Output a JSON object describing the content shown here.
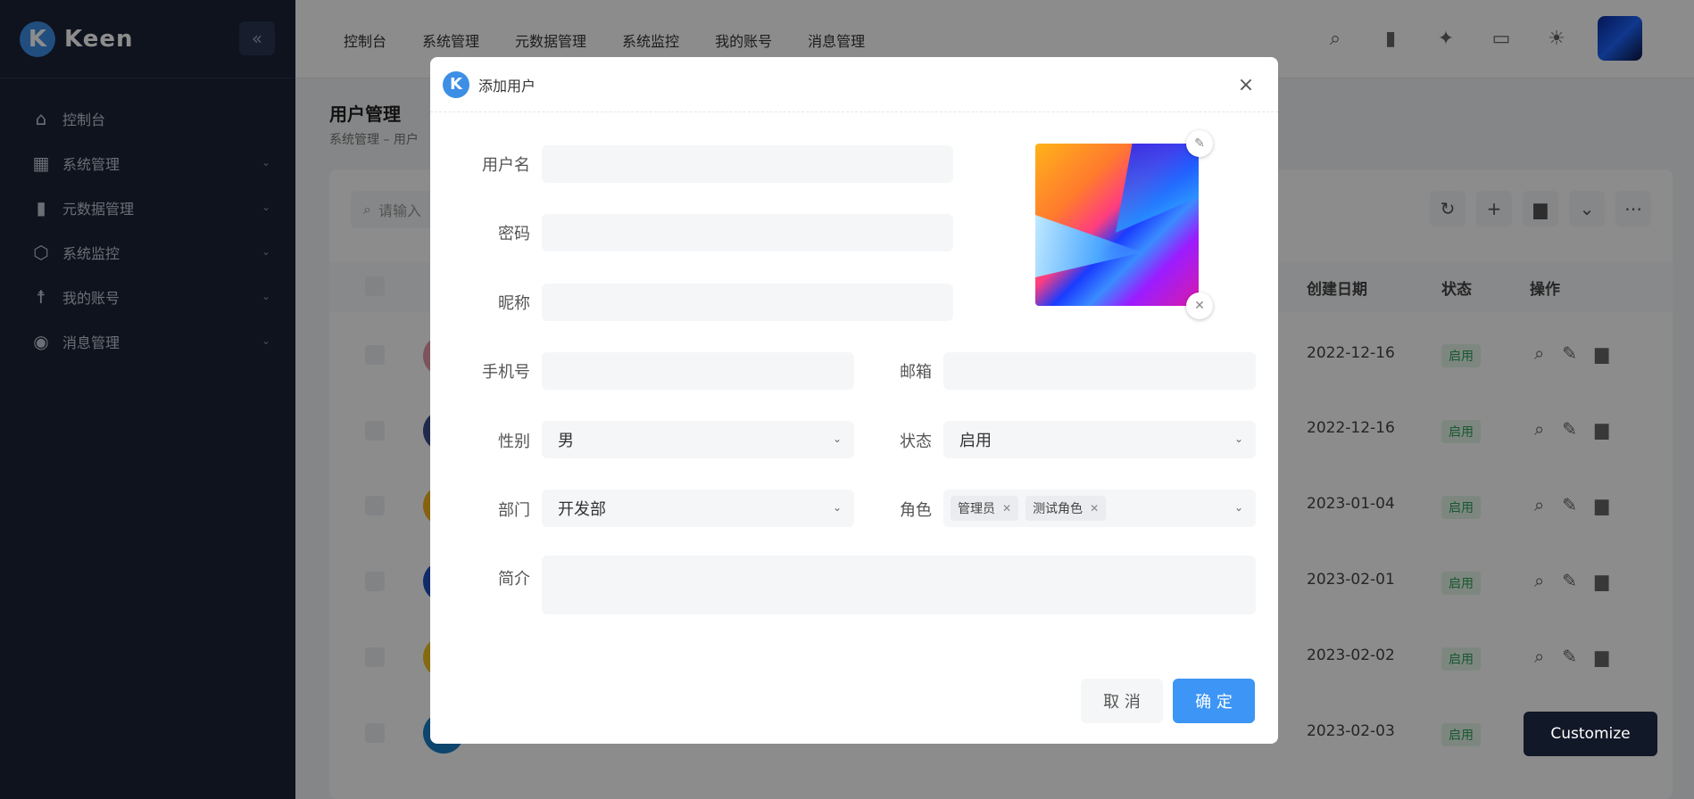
{
  "app": {
    "name": "Keen",
    "logo_letter": "K"
  },
  "sidebar": {
    "collapse_icon": "double-chevron-left-icon",
    "items": [
      {
        "label": "控制台",
        "icon": "home-icon",
        "glyph": "⌂"
      },
      {
        "label": "系统管理",
        "icon": "grid-icon",
        "glyph": "▦"
      },
      {
        "label": "元数据管理",
        "icon": "bar-chart-icon",
        "glyph": "▮"
      },
      {
        "label": "系统监控",
        "icon": "cube-icon",
        "glyph": "⬡"
      },
      {
        "label": "我的账号",
        "icon": "person-icon",
        "glyph": "☨"
      },
      {
        "label": "消息管理",
        "icon": "messenger-icon",
        "glyph": "◉"
      }
    ]
  },
  "topnav": [
    "控制台",
    "系统管理",
    "元数据管理",
    "系统监控",
    "我的账号",
    "消息管理"
  ],
  "page": {
    "title": "用户管理",
    "breadcrumb": "系统管理 – 用户",
    "search_placeholder": "请输入",
    "table_headers": {
      "created": "创建日期",
      "status": "状态",
      "ops": "操作"
    },
    "rows": [
      {
        "date": "2022-12-16",
        "status": "启用"
      },
      {
        "date": "2022-12-16",
        "status": "启用"
      },
      {
        "date": "2023-01-04",
        "status": "启用"
      },
      {
        "date": "2023-02-01",
        "status": "启用"
      },
      {
        "date": "2023-02-02",
        "status": "启用"
      },
      {
        "date": "2023-02-03",
        "status": "启用"
      }
    ]
  },
  "customize_label": "Customize",
  "modal": {
    "title": "添加用户",
    "fields": {
      "username_label": "用户名",
      "username_value": "",
      "password_label": "密码",
      "password_value": "",
      "nickname_label": "昵称",
      "nickname_value": "",
      "phone_label": "手机号",
      "phone_value": "",
      "email_label": "邮箱",
      "email_value": "",
      "gender_label": "性别",
      "gender_value": "男",
      "status_label": "状态",
      "status_value": "启用",
      "dept_label": "部门",
      "dept_value": "开发部",
      "role_label": "角色",
      "roles": [
        "管理员",
        "测试角色"
      ],
      "bio_label": "简介",
      "bio_value": ""
    },
    "cancel_label": "取 消",
    "ok_label": "确 定"
  },
  "colors": {
    "sidebar_bg": "#1b2337",
    "primary": "#3d95f5",
    "status_green": "#2e9e57"
  }
}
